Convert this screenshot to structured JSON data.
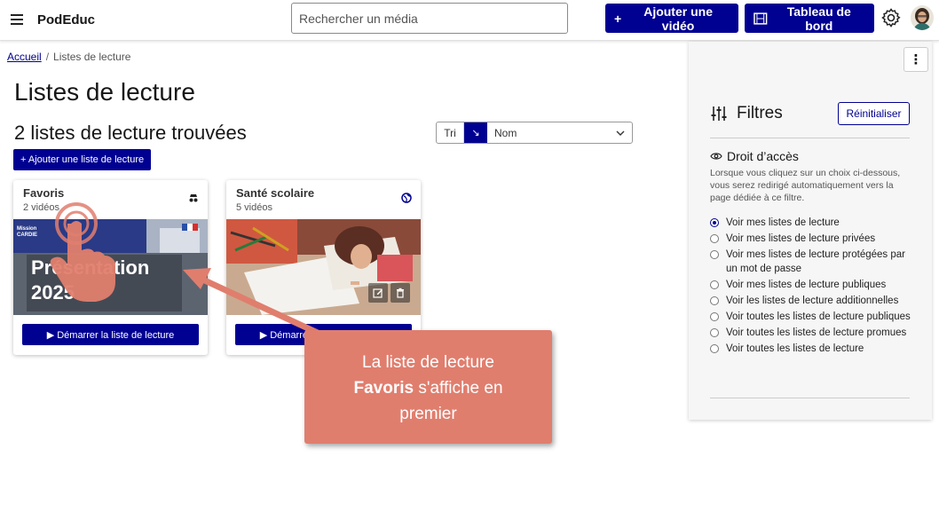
{
  "header": {
    "brand": "PodEduc",
    "search_placeholder": "Rechercher un média",
    "add_video_label": "Ajouter une vidéo",
    "dashboard_label": "Tableau de bord",
    "accent_color": "#000091"
  },
  "breadcrumb": {
    "home": "Accueil",
    "separator": "/",
    "current": "Listes de lecture"
  },
  "main": {
    "title": "Listes de lecture",
    "count_label": "2 listes de lecture trouvées",
    "sort": {
      "label": "Tri",
      "direction_icon": "↘",
      "selected": "Nom"
    },
    "add_list_label": "+ Ajouter une liste de lecture",
    "cards": [
      {
        "title": "Favoris",
        "subtitle": "2 vidéos",
        "visibility_icon": "spy-icon",
        "thumb_tag": "Mission CARDIE",
        "thumb_text_line1": "Présentation",
        "thumb_text_line2": "2025",
        "start_label": "Démarrer la liste de lecture"
      },
      {
        "title": "Santé scolaire",
        "subtitle": "5 vidéos",
        "visibility_icon": "globe-icon",
        "start_label": "Démarrer la liste de lecture"
      }
    ]
  },
  "filters": {
    "title": "Filtres",
    "reset_label": "Réinitialiser",
    "access_title": "Droit d’accès",
    "access_help": "Lorsque vous cliquez sur un choix ci-dessous, vous serez redirigé automatiquement vers la page dédiée à ce filtre.",
    "options": [
      {
        "label": "Voir mes listes de lecture",
        "checked": true
      },
      {
        "label": "Voir mes listes de lecture privées",
        "checked": false
      },
      {
        "label": "Voir mes listes de lecture protégées par un mot de passe",
        "checked": false
      },
      {
        "label": "Voir mes listes de lecture publiques",
        "checked": false
      },
      {
        "label": "Voir les listes de lecture additionnelles",
        "checked": false
      },
      {
        "label": "Voir toutes les listes de lecture publiques",
        "checked": false
      },
      {
        "label": "Voir toutes les listes de lecture promues",
        "checked": false
      },
      {
        "label": "Voir toutes les listes de lecture",
        "checked": false
      }
    ]
  },
  "annotation": {
    "line1": "La liste de lecture",
    "line2_bold": "Favoris",
    "line2_rest": " s'affiche en",
    "line3": "premier",
    "color": "#e07e6e"
  }
}
